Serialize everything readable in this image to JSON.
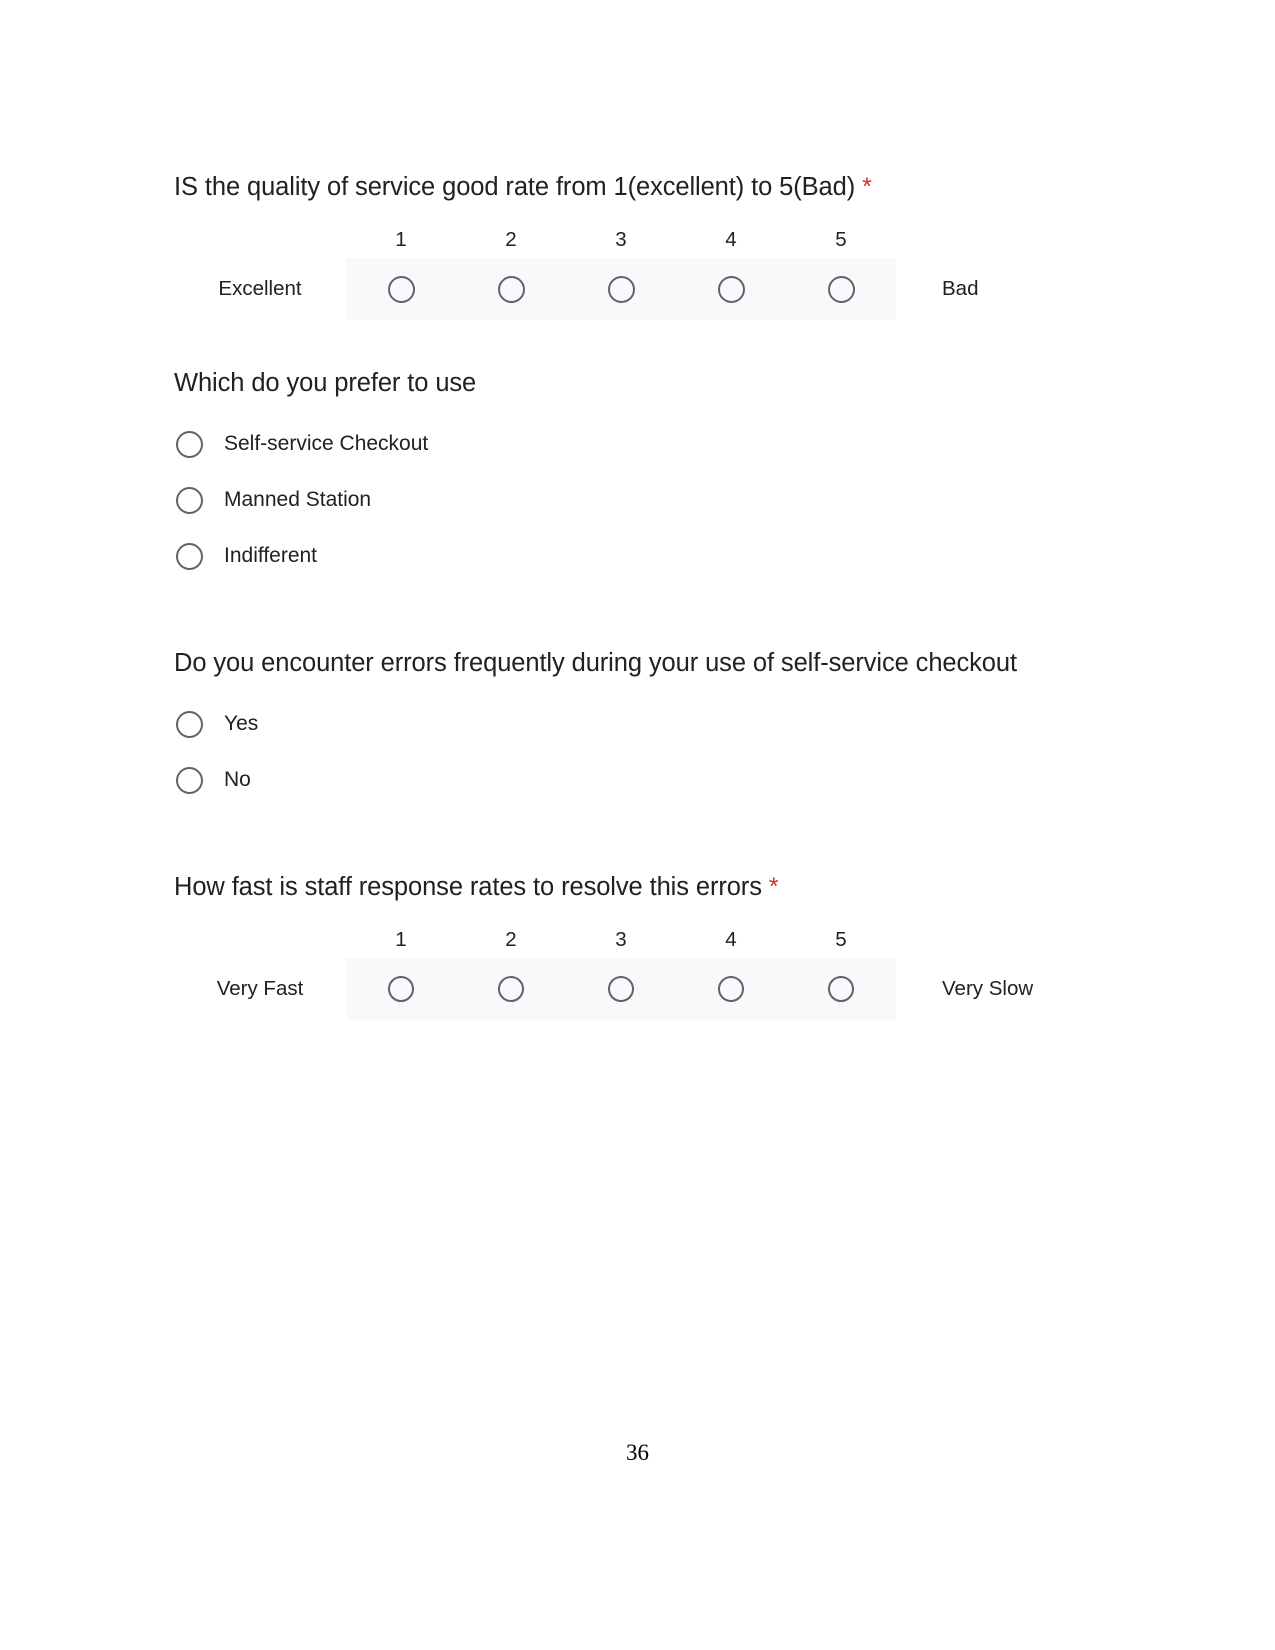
{
  "document": {
    "page_number": "36"
  },
  "questions": [
    {
      "id": "q-service-quality",
      "title": "IS the quality of service good rate from 1(excellent) to 5(Bad)",
      "required": true,
      "required_marker": "*",
      "type": "linear-scale",
      "scale": {
        "numbers": [
          "1",
          "2",
          "3",
          "4",
          "5"
        ],
        "low_label": "Excellent",
        "high_label": "Bad"
      }
    },
    {
      "id": "q-prefer-to-use",
      "title": "Which do you prefer to use",
      "required": false,
      "type": "multiple-choice",
      "options": [
        "Self-service Checkout",
        "Manned Station",
        "Indifferent"
      ]
    },
    {
      "id": "q-errors-frequency",
      "title": "Do you encounter errors frequently during your use of self-service checkout",
      "required": false,
      "type": "multiple-choice",
      "options": [
        "Yes",
        "No"
      ]
    },
    {
      "id": "q-staff-response",
      "title": "How fast is staff response rates to resolve this errors",
      "required": true,
      "required_marker": "*",
      "type": "linear-scale",
      "scale": {
        "numbers": [
          "1",
          "2",
          "3",
          "4",
          "5"
        ],
        "low_label": "Very Fast",
        "high_label": "Very Slow"
      }
    }
  ],
  "colors": {
    "text": "#202124",
    "required_star": "#d93025",
    "scale_band": "#f8f9fa",
    "radio_border": "#5f6368"
  }
}
